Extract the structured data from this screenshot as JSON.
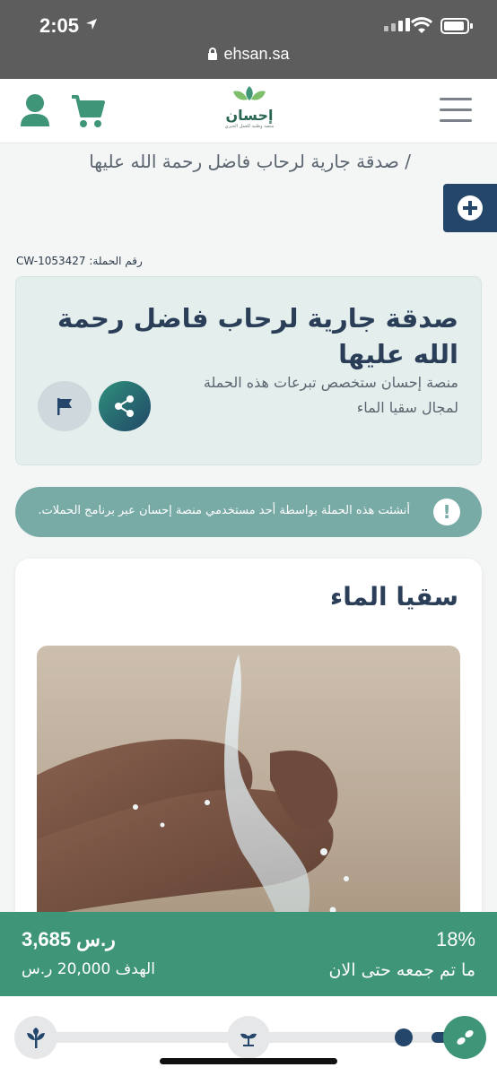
{
  "status_bar": {
    "time": "2:05",
    "url": "ehsan.sa"
  },
  "header": {
    "logo_text": "إحسان",
    "logo_subtitle": "منصة وطنية للعمل الخيري"
  },
  "breadcrumb": "/ صدقة جارية لرحاب فاضل رحمة الله عليها",
  "campaign": {
    "number_label": "رقم الحملة:",
    "number": "CW-1053427",
    "title": "صدقة جارية لرحاب فاضل رحمة الله عليها",
    "subtitle": "منصة إحسان ستخصص تبرعات هذه الحملة لمجال سقيا الماء"
  },
  "notice": "أنشئت هذه الحملة بواسطة أحد مستخدمي منصة إحسان عبر برنامج الحملات.",
  "section": {
    "title": "سقيا الماء"
  },
  "progress": {
    "raised": "3,685 ر.س",
    "goal": "الهدف 20,000 ر.س",
    "percent": "18%",
    "collected_label": "ما تم جمعه حتى الان",
    "fraction": 0.18
  },
  "colors": {
    "brand_green": "#3f9577",
    "navy": "#24466b",
    "teal_notice": "#78aaa6"
  }
}
